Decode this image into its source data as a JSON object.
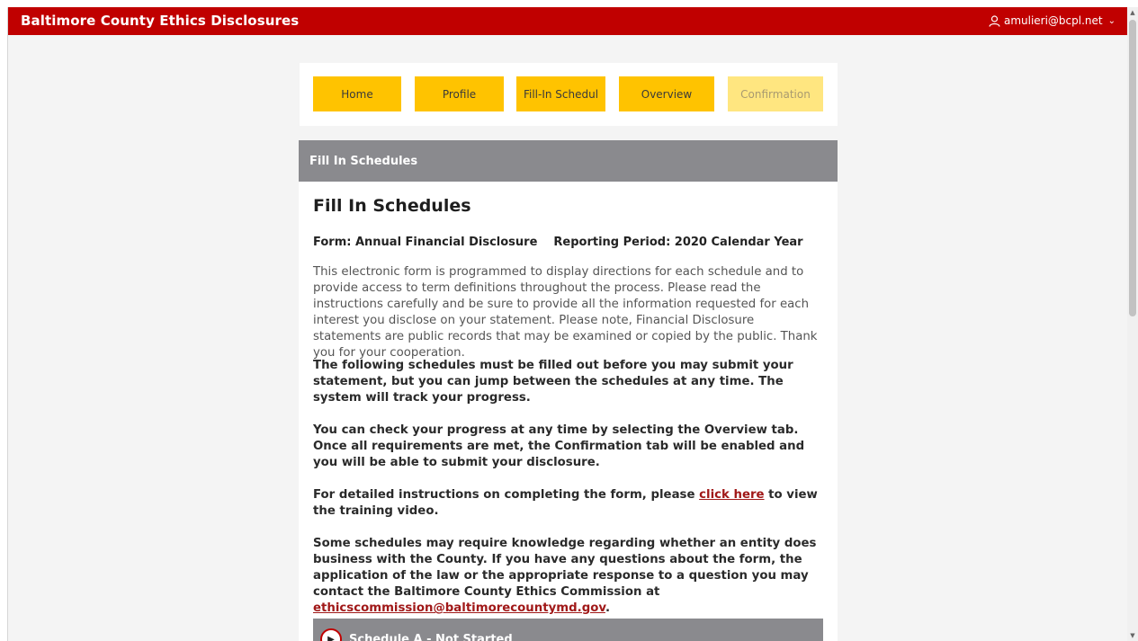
{
  "app": {
    "title": "Baltimore County Ethics Disclosures",
    "user": "amulieri@bcpl.net"
  },
  "tabs": [
    {
      "label": "Home",
      "enabled": true
    },
    {
      "label": "Profile",
      "enabled": true
    },
    {
      "label": "Fill-In Schedul",
      "enabled": true
    },
    {
      "label": "Overview",
      "enabled": true
    },
    {
      "label": "Confirmation",
      "enabled": false
    }
  ],
  "panel": {
    "header": "Fill In Schedules",
    "title": "Fill In Schedules",
    "form_label": "Form: Annual Financial Disclosure",
    "period_label": "Reporting Period: 2020 Calendar Year",
    "intro": "This electronic form is programmed to display directions for each schedule and to provide access to term definitions throughout the process. Please read the instructions carefully and be sure to provide all the information requested for each interest you disclose on your statement. Please note, Financial Disclosure statements are public records that may be examined or copied by the public. Thank you for your cooperation.",
    "para_required": "The following schedules must be filled out before you may submit your statement, but you can jump between the schedules at any time. The system will track your progress.",
    "para_progress": "You can check your progress at any time by selecting the Overview tab. Once all requirements are met, the Confirmation tab will be enabled and you will be able to submit your disclosure.",
    "para_video_before": "For detailed instructions on completing the form, please ",
    "para_video_link": "click here",
    "para_video_after": " to view the training video.",
    "para_contact_before": "Some schedules may require knowledge regarding whether an entity does business with the County. If you have any questions about the form, the application of the law or the appropriate response to a question you may contact the Baltimore County Ethics Commission at ",
    "para_contact_link": "ethicscommission@baltimorecountymd.gov",
    "para_contact_after": "."
  },
  "schedule_a": {
    "label": "Schedule A - Not Started",
    "icon": "play-icon"
  },
  "colors": {
    "topbar": "#c00000",
    "tab": "#ffc300",
    "tab_disabled": "#ffe680",
    "panel_header": "#8a8a8e",
    "link": "#a01818"
  }
}
